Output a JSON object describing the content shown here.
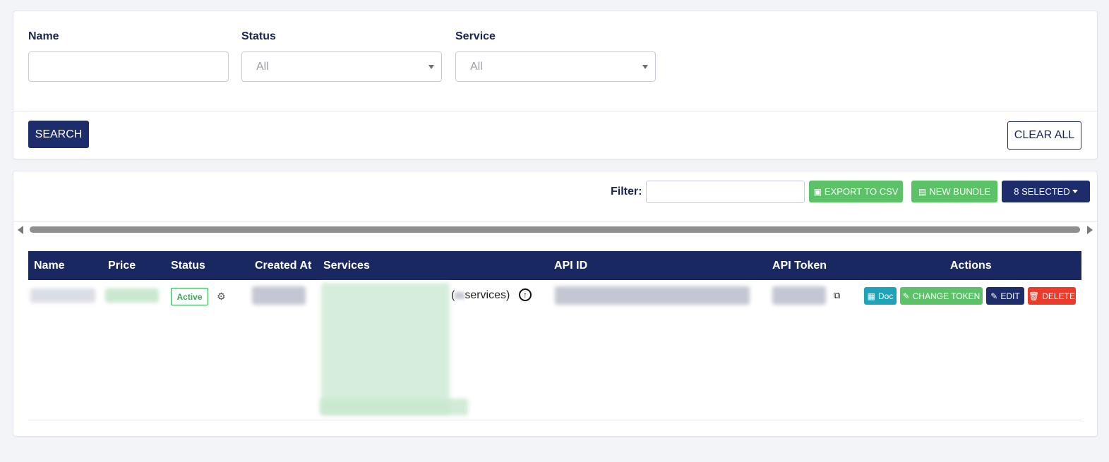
{
  "search": {
    "name_label": "Name",
    "name_value": "",
    "status_label": "Status",
    "status_value": "All",
    "service_label": "Service",
    "service_value": "All",
    "search_button": "SEARCH",
    "clear_button": "CLEAR ALL"
  },
  "toolbar": {
    "filter_label": "Filter:",
    "filter_value": "",
    "export_button": "EXPORT TO CSV",
    "new_bundle_button": "NEW BUNDLE",
    "selected_button": "8 SELECTED"
  },
  "table": {
    "columns": [
      "Name",
      "Price",
      "Status",
      "Created At",
      "Services",
      "API ID",
      "API Token",
      "Actions"
    ],
    "rows": [
      {
        "status": "Active",
        "services_open": "(",
        "services_suffix": "services)",
        "actions": {
          "doc": "Doc",
          "change_token": "CHANGE TOKEN",
          "edit": "EDIT",
          "delete": "DELETE"
        }
      }
    ]
  },
  "colors": {
    "primary": "#1d2c6b",
    "header": "#1a2861",
    "success": "#5cc267",
    "info": "#1fa3b8",
    "danger": "#eb3b2a",
    "active_badge": "#33a853"
  },
  "icons": [
    "chevron-down-icon",
    "file-excel-icon",
    "file-icon",
    "caret-down-icon",
    "gear-icon",
    "arrow-up-circle-icon",
    "copy-icon",
    "book-icon",
    "edit-icon",
    "trash-icon"
  ]
}
